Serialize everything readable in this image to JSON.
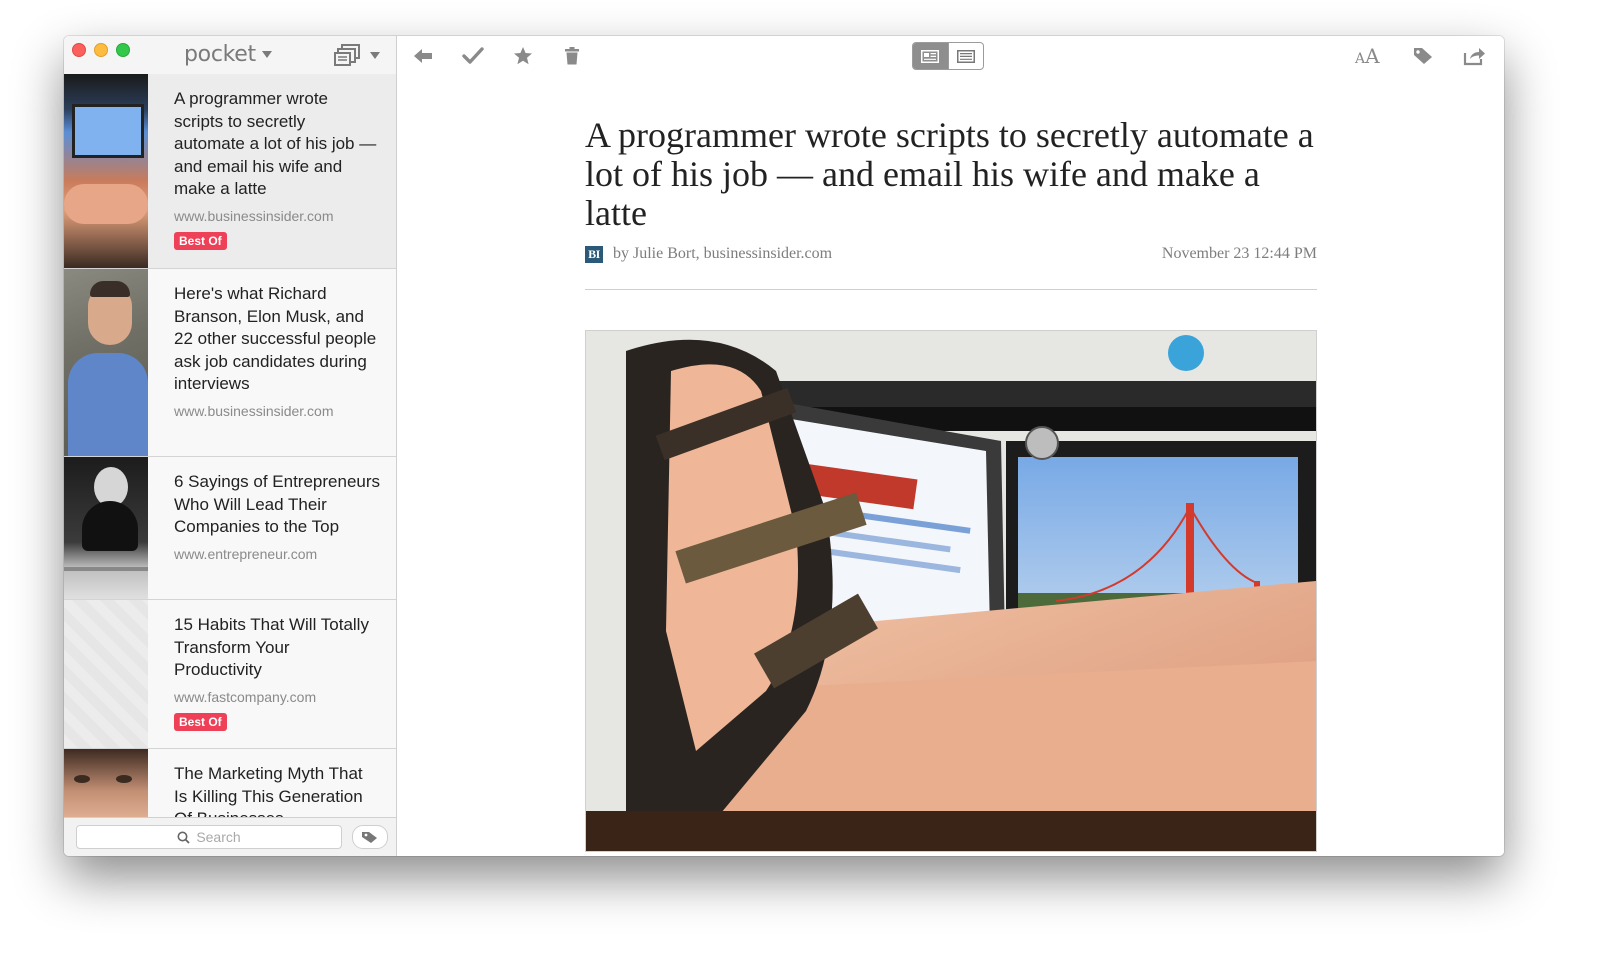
{
  "app": {
    "brand": "pocket"
  },
  "sidebar": {
    "items": [
      {
        "title": "A programmer wrote scripts to secretly automate a lot of his job — and email his wife and make a latte",
        "domain": "www.businessinsider.com",
        "badge": "Best Of"
      },
      {
        "title": "Here's what Richard Branson, Elon Musk, and 22 other successful people ask job candidates during interviews",
        "domain": "www.businessinsider.com"
      },
      {
        "title": "6 Sayings of Entrepreneurs Who Will Lead Their Companies to the Top",
        "domain": "www.entrepreneur.com"
      },
      {
        "title": "15 Habits That Will Totally Transform Your Productivity",
        "domain": "www.fastcompany.com",
        "badge": "Best Of"
      },
      {
        "title": "The Marketing Myth That Is Killing This Generation Of Businesses",
        "domain": ""
      }
    ],
    "search_placeholder": "Search"
  },
  "article": {
    "title": "A programmer wrote scripts to secretly automate a lot of his job — and email his wife and make a latte",
    "source_logo": "BI",
    "byline": "by Julie Bort, businessinsider.com",
    "date": "November 23 12:44 PM"
  },
  "toolbar": {
    "font_small": "A",
    "font_big": "A"
  },
  "colors": {
    "badge": "#ee4056",
    "accent_gray": "#8e8e8e"
  },
  "icons": [
    "back-arrow-icon",
    "checkmark-icon",
    "star-icon",
    "trash-icon",
    "article-view-icon",
    "web-view-icon",
    "font-size-icon",
    "tag-icon",
    "share-icon",
    "search-icon",
    "list-view-icon"
  ]
}
